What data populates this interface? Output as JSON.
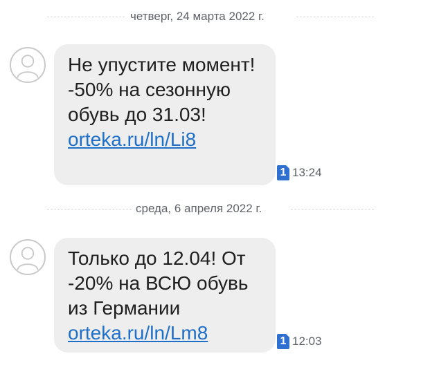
{
  "conversation": {
    "groups": [
      {
        "date_label": "четверг, 24 марта 2022 г.",
        "message": {
          "text": "Не упустите момент! -50% на сезонную обувь до 31.03! ",
          "link": "orteka.ru/ln/Li8",
          "sim": "1",
          "time": "13:24"
        }
      },
      {
        "date_label": "среда, 6 апреля 2022 г.",
        "message": {
          "text": "Только до 12.04! От -20% на ВСЮ обувь из Германии ",
          "link": "orteka.ru/ln/Lm8",
          "sim": "1",
          "time": "12:03"
        }
      }
    ]
  },
  "icons": {
    "avatar": "contact-avatar-icon",
    "sim": "sim-card-icon"
  },
  "colors": {
    "bubble": "#eeeeee",
    "link": "#1e6fc8",
    "sim_badge": "#2f6fcf",
    "meta_text": "#5f6368"
  }
}
